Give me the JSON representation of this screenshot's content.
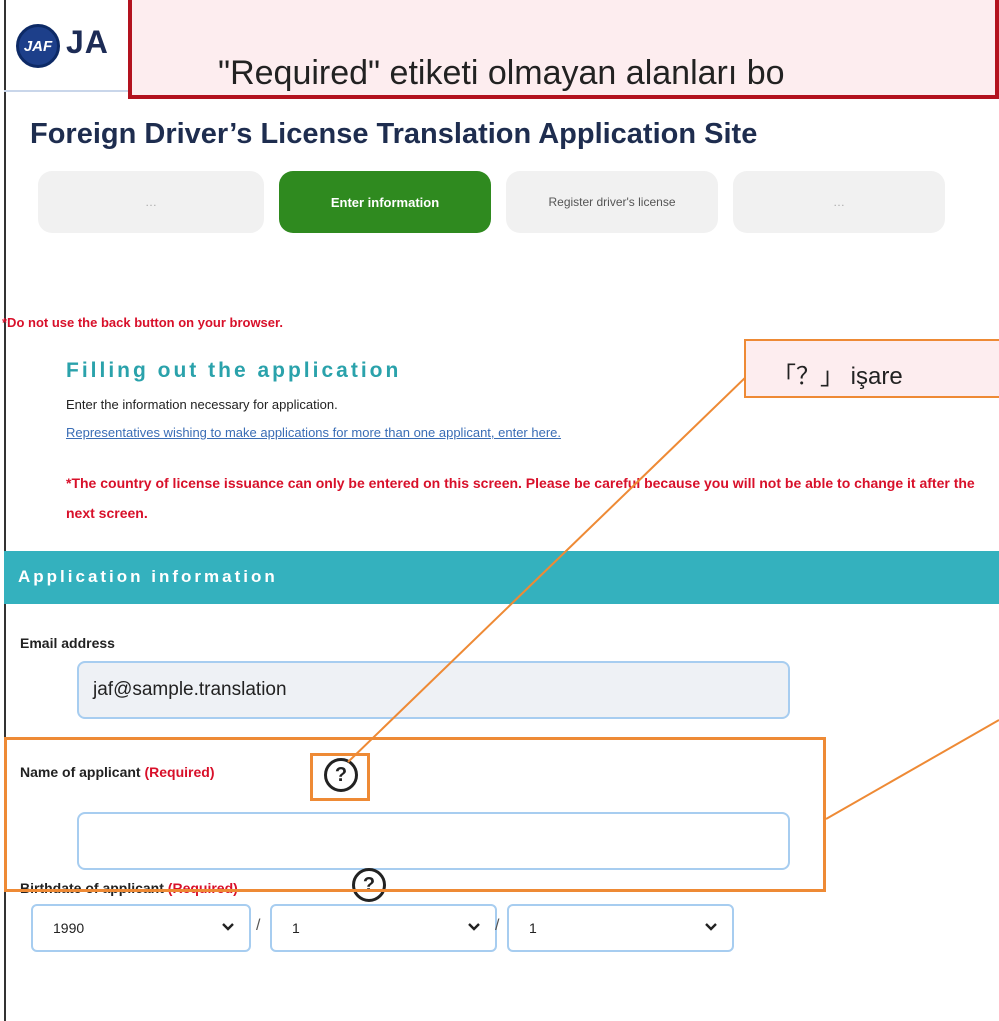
{
  "header": {
    "logo_text": "JA",
    "logo_emblem": "JAF"
  },
  "page_title": "Foreign Driver’s License Translation Application Site",
  "steps": [
    {
      "label": "…",
      "state": "inactive"
    },
    {
      "label": "Enter information",
      "state": "active"
    },
    {
      "label": "Register driver's license",
      "state": "inactive"
    },
    {
      "label": "…",
      "state": "inactive"
    }
  ],
  "back_warning": "*Do not use the back button on your browser.",
  "filling": {
    "title": "Filling out the application",
    "description": "Enter the information necessary for application.",
    "representatives_link": "Representatives wishing to make applications for more than one applicant, enter here.",
    "country_note": "*The country of license issuance can only be entered on this screen. Please be careful because you will not be able to change it after the next screen."
  },
  "section_title": "Application information",
  "form": {
    "email": {
      "label": "Email address",
      "value": "jaf@sample.translation"
    },
    "name": {
      "label": "Name of applicant",
      "required": "(Required)",
      "value": ""
    },
    "birthdate": {
      "label": "Birthdate of applicant",
      "required": "(Required)",
      "year": "1990",
      "month": "1",
      "day": "1",
      "separator": "/"
    },
    "help_symbol": "?"
  },
  "annotations": {
    "banner_text": "\"Required\" etiketi olmayan alanları bo",
    "callout_text": "「？」 işare",
    "accent_color": "#ee8a35",
    "banner_border_color": "#b3121e"
  },
  "colors": {
    "active_step": "#2f8a1f",
    "section_bar": "#34b1be",
    "warning": "#d8102a"
  }
}
